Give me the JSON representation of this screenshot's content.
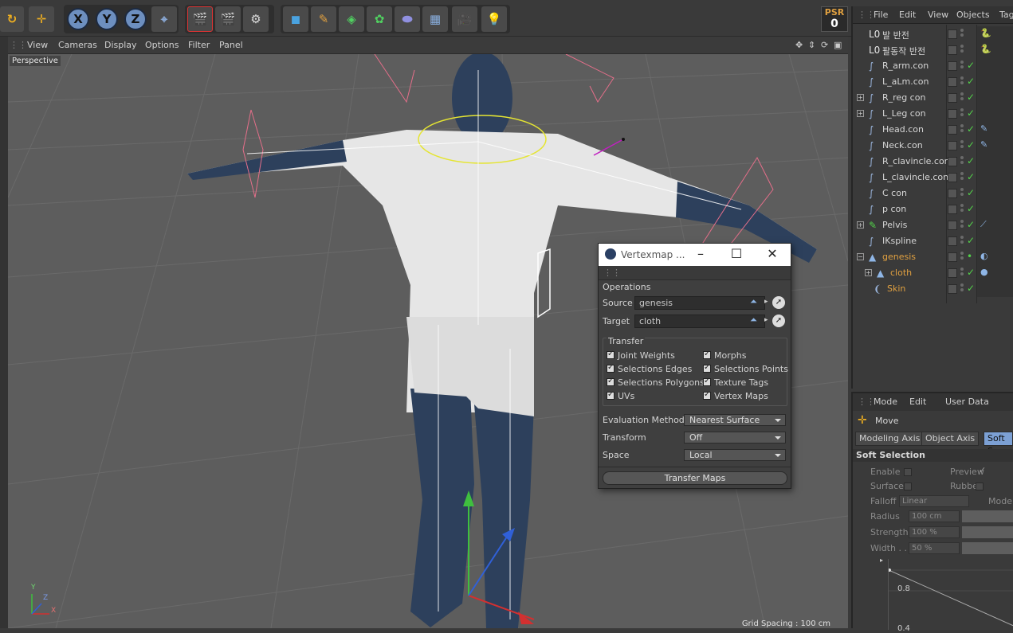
{
  "toolbar": {
    "axis_x": "X",
    "axis_y": "Y",
    "axis_z": "Z",
    "psr_label": "PSR",
    "psr_value": "0"
  },
  "viewport": {
    "menu": [
      "View",
      "Cameras",
      "Display",
      "Options",
      "Filter",
      "Panel"
    ],
    "camera_label": "Perspective",
    "grid_spacing": "Grid Spacing : 100 cm",
    "axis_y": "Y",
    "axis_z": "Z",
    "axis_x": "X"
  },
  "object_manager": {
    "menu": [
      "File",
      "Edit",
      "View",
      "Objects",
      "Tags"
    ],
    "objects": [
      {
        "name": "발 반전",
        "icon": "null-icon"
      },
      {
        "name": "팔동작 반전",
        "icon": "null-icon"
      },
      {
        "name": "R_arm.con",
        "icon": "spline-icon"
      },
      {
        "name": "L_aLm.con",
        "icon": "spline-icon"
      },
      {
        "name": "R_reg con",
        "icon": "spline-icon"
      },
      {
        "name": "L_Leg con",
        "icon": "spline-icon"
      },
      {
        "name": "Head.con",
        "icon": "spline-icon"
      },
      {
        "name": "Neck.con",
        "icon": "spline-icon"
      },
      {
        "name": "R_clavincle.con",
        "icon": "spline-icon"
      },
      {
        "name": "L_clavincle.con",
        "icon": "spline-icon"
      },
      {
        "name": "C con",
        "icon": "spline-icon"
      },
      {
        "name": "p con",
        "icon": "spline-icon"
      },
      {
        "name": "Pelvis",
        "icon": "joint-icon"
      },
      {
        "name": "IKspline",
        "icon": "spline-icon"
      },
      {
        "name": "genesis",
        "icon": "polygon-icon"
      },
      {
        "name": "cloth",
        "icon": "polygon-icon"
      },
      {
        "name": "Skin",
        "icon": "skin-icon"
      }
    ]
  },
  "attribute_manager": {
    "menu": [
      "Mode",
      "Edit",
      "User Data"
    ],
    "tool_name": "Move",
    "tabs": [
      "Modeling Axis",
      "Object Axis",
      "Soft Se"
    ],
    "section": "Soft Selection",
    "enable_label": "Enable",
    "preview_label": "Preview",
    "surface_label": "Surface",
    "rubber_label": "Rubber",
    "falloff_label": "Falloff",
    "falloff_value": "Linear",
    "mode_label": "Mode",
    "radius_label": "Radius",
    "radius_value": "100 cm",
    "strength_label": "Strength",
    "strength_value": "100 %",
    "width_label": "Width . .",
    "width_value": "50 %",
    "graph_tick_1": "0.8",
    "graph_tick_2": "0.4"
  },
  "dialog": {
    "title": "Vertexmap ...",
    "operations_label": "Operations",
    "source_label": "Source",
    "source_value": "genesis",
    "target_label": "Target",
    "target_value": "cloth",
    "transfer_label": "Transfer",
    "checkboxes": [
      "Joint Weights",
      "Morphs",
      "Selections Edges",
      "Selections Points",
      "Selections Polygons",
      "Texture Tags",
      "UVs",
      "Vertex Maps"
    ],
    "eval_label": "Evaluation Method",
    "eval_value": "Nearest Surface",
    "transform_label": "Transform",
    "transform_value": "Off",
    "space_label": "Space",
    "space_value": "Local",
    "button_label": "Transfer Maps"
  },
  "colors": {
    "accent": "#7ca0d4",
    "check_green": "#53d14a",
    "orange": "#e0a040"
  }
}
